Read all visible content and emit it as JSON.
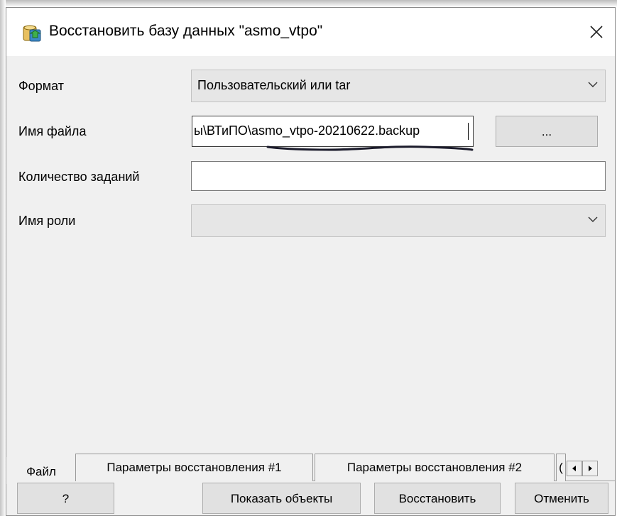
{
  "window": {
    "title": "Восстановить базу данных \"asmo_vtpo\"",
    "icon": "database-restore-icon",
    "close_icon": "close-icon"
  },
  "form": {
    "format": {
      "label": "Формат",
      "value": "Пользовательский или tar"
    },
    "filename": {
      "label": "Имя файла",
      "value": "ы\\ВТиПО\\asmo_vtpo-20210622.backup",
      "browse_label": "..."
    },
    "jobs": {
      "label": "Количество заданий",
      "value": ""
    },
    "role": {
      "label": "Имя роли",
      "value": ""
    }
  },
  "tabs": [
    {
      "label": "Файл",
      "active": true
    },
    {
      "label": "Параметры восстановления #1",
      "active": false
    },
    {
      "label": "Параметры восстановления #2",
      "active": false
    },
    {
      "label": "(",
      "active": false
    }
  ],
  "buttons": {
    "help": "?",
    "show_objects": "Показать объекты",
    "restore": "Восстановить",
    "cancel": "Отменить"
  },
  "colors": {
    "dialog_bg": "#f0f0f0",
    "combo_bg": "#e6e6e6",
    "button_bg": "#e1e1e1"
  }
}
